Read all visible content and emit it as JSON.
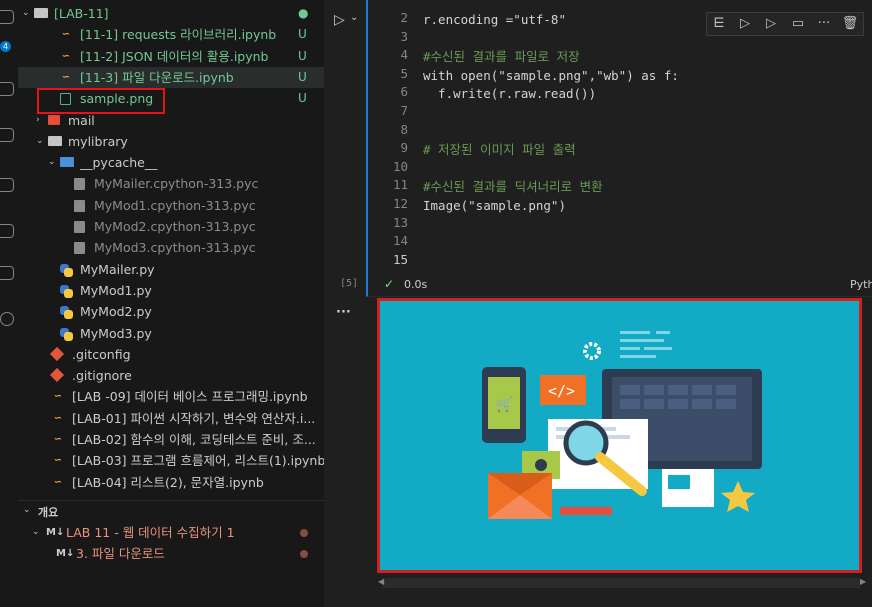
{
  "activity_badge": "4",
  "explorer": {
    "items": [
      {
        "label": "[LAB-11]",
        "status": "●",
        "kind": "folder-open"
      },
      {
        "label": "[11-1] requests 라이브러리.ipynb",
        "status": "U",
        "kind": "notebook"
      },
      {
        "label": "[11-2] JSON 데이터의 활용.ipynb",
        "status": "U",
        "kind": "notebook"
      },
      {
        "label": "[11-3] 파일 다운로드.ipynb",
        "status": "U",
        "kind": "notebook"
      },
      {
        "label": "sample.png",
        "status": "U",
        "kind": "image"
      },
      {
        "label": "mail",
        "status": "",
        "kind": "folder"
      },
      {
        "label": "mylibrary",
        "status": "",
        "kind": "folder-open"
      },
      {
        "label": "__pycache__",
        "status": "",
        "kind": "folder-open"
      },
      {
        "label": "MyMailer.cpython-313.pyc",
        "status": "",
        "kind": "pyc"
      },
      {
        "label": "MyMod1.cpython-313.pyc",
        "status": "",
        "kind": "pyc"
      },
      {
        "label": "MyMod2.cpython-313.pyc",
        "status": "",
        "kind": "pyc"
      },
      {
        "label": "MyMod3.cpython-313.pyc",
        "status": "",
        "kind": "pyc"
      },
      {
        "label": "MyMailer.py",
        "status": "",
        "kind": "python"
      },
      {
        "label": "MyMod1.py",
        "status": "",
        "kind": "python"
      },
      {
        "label": "MyMod2.py",
        "status": "",
        "kind": "python"
      },
      {
        "label": "MyMod3.py",
        "status": "",
        "kind": "python"
      },
      {
        "label": ".gitconfig",
        "status": "",
        "kind": "git"
      },
      {
        "label": ".gitignore",
        "status": "",
        "kind": "git"
      },
      {
        "label": "[LAB -09] 데이터 베이스 프로그래밍.ipynb",
        "status": "",
        "kind": "notebook"
      },
      {
        "label": "[LAB-01] 파이썬 시작하기, 변수와 연산자.i...",
        "status": "",
        "kind": "notebook"
      },
      {
        "label": "[LAB-02] 함수의 이해, 코딩테스트 준비, 조...",
        "status": "",
        "kind": "notebook"
      },
      {
        "label": "[LAB-03] 프로그램 흐름제어, 리스트(1).ipynb",
        "status": "",
        "kind": "notebook"
      },
      {
        "label": "[LAB-04] 리스트(2), 문자열.ipynb",
        "status": "",
        "kind": "notebook"
      }
    ]
  },
  "outline": {
    "header": "개요",
    "items": [
      {
        "badge": "M↓",
        "label": "LAB 11 - 웹 데이터 수집하기 1"
      },
      {
        "badge": "M↓",
        "label": "3. 파일 다운로드"
      }
    ]
  },
  "cell": {
    "exec_count": "[5]",
    "time": "0.0s",
    "kernel": "Pyth",
    "lines": [
      {
        "n": "2",
        "text": "r.encoding =\"utf-8\""
      },
      {
        "n": "3",
        "text": ""
      },
      {
        "n": "4",
        "text": "#수신된 결과를 파일로 저장"
      },
      {
        "n": "5",
        "text": "with open(\"sample.png\",\"wb\") as f:"
      },
      {
        "n": "6",
        "text": "  f.write(r.raw.read())"
      },
      {
        "n": "7",
        "text": ""
      },
      {
        "n": "8",
        "text": ""
      },
      {
        "n": "9",
        "text": "# 저장된 이미지 파일 출력"
      },
      {
        "n": "10",
        "text": ""
      },
      {
        "n": "11",
        "text": "#수신된 결과를 딕셔너리로 변환"
      },
      {
        "n": "12",
        "text": "Image(\"sample.png\")"
      },
      {
        "n": "13",
        "text": ""
      },
      {
        "n": "14",
        "text": ""
      },
      {
        "n": "15",
        "text": ""
      }
    ]
  },
  "output_ellipsis": "···",
  "illustration": {
    "code_tag": "</>"
  },
  "colors": {
    "accent": "#2478d4",
    "highlight_border": "#e51515",
    "illustration_bg": "#13aac6",
    "untracked": "#73c991",
    "notebook_icon": "#f0a43a"
  }
}
